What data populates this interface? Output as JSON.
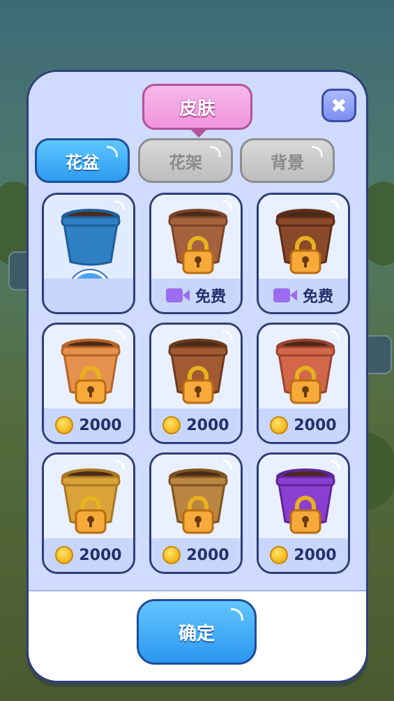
{
  "dialog": {
    "title": "皮肤",
    "close_icon": "close-icon"
  },
  "tabs": [
    {
      "label": "花盆",
      "active": true
    },
    {
      "label": "花架",
      "active": false
    },
    {
      "label": "背景",
      "active": false
    }
  ],
  "items": [
    {
      "pot_color": "#2f7fc4",
      "pot_rim": "#1f5f99",
      "state": "selected",
      "price": ""
    },
    {
      "pot_color": "#a5623e",
      "pot_rim": "#7e4428",
      "state": "free",
      "price": "免费"
    },
    {
      "pot_color": "#8a4a2a",
      "pot_rim": "#5f2e18",
      "state": "free",
      "price": "免费"
    },
    {
      "pot_color": "#e7914f",
      "pot_rim": "#b86424",
      "state": "coin",
      "price": "2000"
    },
    {
      "pot_color": "#a15a32",
      "pot_rim": "#6e3a1c",
      "state": "coin",
      "price": "2000"
    },
    {
      "pot_color": "#d2674a",
      "pot_rim": "#9e4330",
      "state": "coin",
      "price": "2000"
    },
    {
      "pot_color": "#d9a33a",
      "pot_rim": "#a97822",
      "state": "coin",
      "price": "2000"
    },
    {
      "pot_color": "#b98540",
      "pot_rim": "#7e5520",
      "state": "coin",
      "price": "2000"
    },
    {
      "pot_color": "#8a3fd0",
      "pot_rim": "#5f2599",
      "state": "coin",
      "price": "2000"
    }
  ],
  "confirm_label": "确定",
  "colors": {
    "accent": "#2d9bf0",
    "title_pink": "#ef94dc",
    "panel": "#cfdbff"
  }
}
